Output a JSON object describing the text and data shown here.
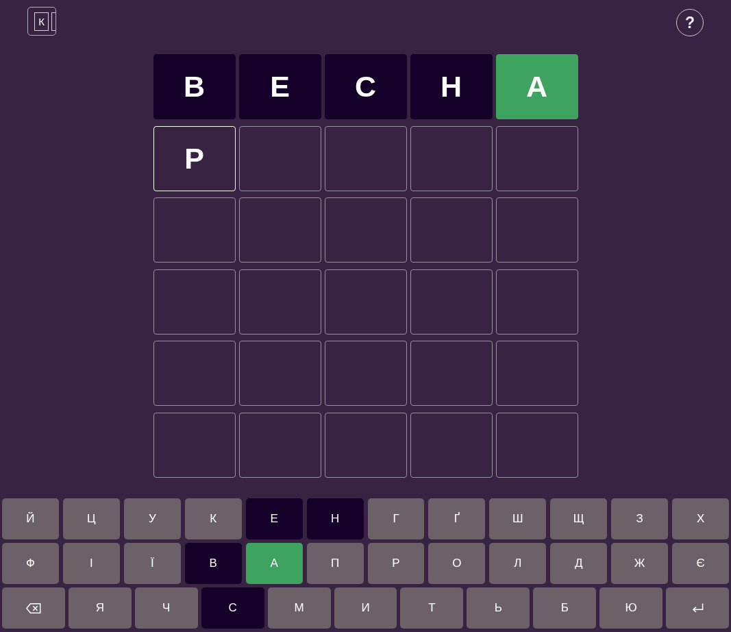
{
  "header": {
    "logo": {
      "letter": "К"
    },
    "help_button": {
      "label": "?"
    }
  },
  "board": {
    "rows": [
      {
        "tiles": [
          {
            "letter": "В",
            "absent": true,
            "correct": false
          },
          {
            "letter": "Е",
            "absent": true,
            "correct": false
          },
          {
            "letter": "С",
            "absent": true,
            "correct": false
          },
          {
            "letter": "Н",
            "absent": true,
            "correct": false
          },
          {
            "letter": "А",
            "absent": false,
            "correct": true
          }
        ]
      },
      {
        "tiles": [
          {
            "letter": "Р",
            "absent": false,
            "correct": false
          },
          {
            "absent": false,
            "correct": false
          },
          {
            "absent": false,
            "correct": false
          },
          {
            "absent": false,
            "correct": false
          },
          {
            "absent": false,
            "correct": false
          }
        ]
      },
      {
        "tiles": [
          {
            "absent": false,
            "correct": false
          },
          {
            "absent": false,
            "correct": false
          },
          {
            "absent": false,
            "correct": false
          },
          {
            "absent": false,
            "correct": false
          },
          {
            "absent": false,
            "correct": false
          }
        ]
      },
      {
        "tiles": [
          {
            "absent": false,
            "correct": false
          },
          {
            "absent": false,
            "correct": false
          },
          {
            "absent": false,
            "correct": false
          },
          {
            "absent": false,
            "correct": false
          },
          {
            "absent": false,
            "correct": false
          }
        ]
      },
      {
        "tiles": [
          {
            "absent": false,
            "correct": false
          },
          {
            "absent": false,
            "correct": false
          },
          {
            "absent": false,
            "correct": false
          },
          {
            "absent": false,
            "correct": false
          },
          {
            "absent": false,
            "correct": false
          }
        ]
      },
      {
        "tiles": [
          {
            "absent": false,
            "correct": false
          },
          {
            "absent": false,
            "correct": false
          },
          {
            "absent": false,
            "correct": false
          },
          {
            "absent": false,
            "correct": false
          },
          {
            "absent": false,
            "correct": false
          }
        ]
      }
    ]
  },
  "keyboard": {
    "rows": [
      {
        "keys": [
          {
            "kind": "letter",
            "label": "Й",
            "absent": false,
            "correct": false
          },
          {
            "kind": "letter",
            "label": "Ц",
            "absent": false,
            "correct": false
          },
          {
            "kind": "letter",
            "label": "У",
            "absent": false,
            "correct": false
          },
          {
            "kind": "letter",
            "label": "К",
            "absent": false,
            "correct": false
          },
          {
            "kind": "letter",
            "label": "Е",
            "absent": true,
            "correct": false
          },
          {
            "kind": "letter",
            "label": "Н",
            "absent": true,
            "correct": false
          },
          {
            "kind": "letter",
            "label": "Г",
            "absent": false,
            "correct": false
          },
          {
            "kind": "letter",
            "label": "Ґ",
            "absent": false,
            "correct": false
          },
          {
            "kind": "letter",
            "label": "Ш",
            "absent": false,
            "correct": false
          },
          {
            "kind": "letter",
            "label": "Щ",
            "absent": false,
            "correct": false
          },
          {
            "kind": "letter",
            "label": "З",
            "absent": false,
            "correct": false
          },
          {
            "kind": "letter",
            "label": "Х",
            "absent": false,
            "correct": false
          }
        ]
      },
      {
        "keys": [
          {
            "kind": "letter",
            "label": "Ф",
            "absent": false,
            "correct": false
          },
          {
            "kind": "letter",
            "label": "І",
            "absent": false,
            "correct": false
          },
          {
            "kind": "letter",
            "label": "Ї",
            "absent": false,
            "correct": false
          },
          {
            "kind": "letter",
            "label": "В",
            "absent": true,
            "correct": false
          },
          {
            "kind": "letter",
            "label": "А",
            "absent": false,
            "correct": true
          },
          {
            "kind": "letter",
            "label": "П",
            "absent": false,
            "correct": false
          },
          {
            "kind": "letter",
            "label": "Р",
            "absent": false,
            "correct": false
          },
          {
            "kind": "letter",
            "label": "О",
            "absent": false,
            "correct": false
          },
          {
            "kind": "letter",
            "label": "Л",
            "absent": false,
            "correct": false
          },
          {
            "kind": "letter",
            "label": "Д",
            "absent": false,
            "correct": false
          },
          {
            "kind": "letter",
            "label": "Ж",
            "absent": false,
            "correct": false
          },
          {
            "kind": "letter",
            "label": "Є",
            "absent": false,
            "correct": false
          }
        ]
      },
      {
        "keys": [
          {
            "kind": "backspace"
          },
          {
            "kind": "letter",
            "label": "Я",
            "absent": false,
            "correct": false
          },
          {
            "kind": "letter",
            "label": "Ч",
            "absent": false,
            "correct": false
          },
          {
            "kind": "letter",
            "label": "С",
            "absent": true,
            "correct": false
          },
          {
            "kind": "letter",
            "label": "М",
            "absent": false,
            "correct": false
          },
          {
            "kind": "letter",
            "label": "И",
            "absent": false,
            "correct": false
          },
          {
            "kind": "letter",
            "label": "Т",
            "absent": false,
            "correct": false
          },
          {
            "kind": "letter",
            "label": "Ь",
            "absent": false,
            "correct": false
          },
          {
            "kind": "letter",
            "label": "Б",
            "absent": false,
            "correct": false
          },
          {
            "kind": "letter",
            "label": "Ю",
            "absent": false,
            "correct": false
          },
          {
            "kind": "enter"
          }
        ]
      }
    ]
  }
}
